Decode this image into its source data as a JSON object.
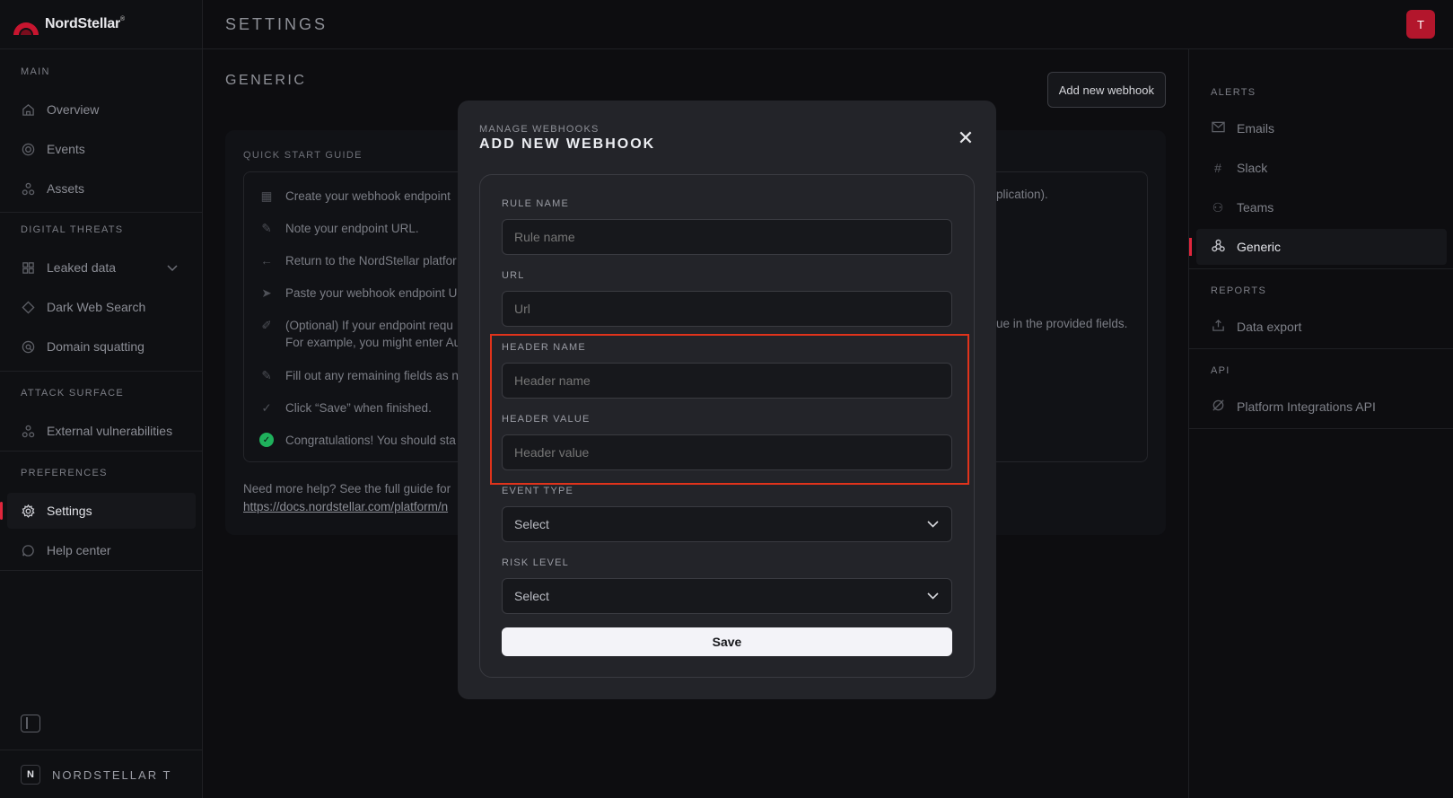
{
  "app": {
    "logo_text": "NordStellar",
    "logo_mark": "®"
  },
  "topbar": {
    "title": "SETTINGS",
    "avatar_letter": "T"
  },
  "sidebar": {
    "sections": [
      {
        "title": "MAIN",
        "items": [
          {
            "label": "Overview",
            "icon": "home-icon"
          },
          {
            "label": "Events",
            "icon": "target-icon"
          },
          {
            "label": "Assets",
            "icon": "assets-icon"
          }
        ]
      },
      {
        "title": "DIGITAL THREATS",
        "items": [
          {
            "label": "Leaked data",
            "icon": "grid-icon"
          },
          {
            "label": "Dark Web Search",
            "icon": "diamond-icon"
          },
          {
            "label": "Domain squatting",
            "icon": "search-icon"
          }
        ]
      },
      {
        "title": "ATTACK SURFACE",
        "items": [
          {
            "label": "External vulnerabilities",
            "icon": "assets-icon"
          }
        ]
      },
      {
        "title": "PREFERENCES",
        "items": [
          {
            "label": "Settings",
            "icon": "gear-icon"
          },
          {
            "label": "Help center",
            "icon": "chat-icon"
          }
        ]
      }
    ],
    "org_badge": "N",
    "org_name": "NORDSTELLAR T"
  },
  "main": {
    "section_title": "GENERIC",
    "add_button": "Add new webhook",
    "guide": {
      "title": "QUICK START GUIDE",
      "steps": [
        "Create your webhook endpoint",
        "Note your endpoint URL.",
        "Return to the NordStellar platfor",
        "Paste your webhook endpoint U",
        "(Optional) If your endpoint requ",
        "For example, you might enter Au",
        "Fill out any remaining fields as n",
        "Click “Save” when finished.",
        "Congratulations! You should sta"
      ],
      "step1_tail": "plication).",
      "step5_tail": "ue in the provided fields.",
      "help_text": "Need more help? See the full guide for",
      "help_link": "https://docs.nordstellar.com/platform/n"
    }
  },
  "rightbar": {
    "sections": [
      {
        "title": "ALERTS",
        "items": [
          {
            "label": "Emails",
            "icon": "mail-icon"
          },
          {
            "label": "Slack",
            "icon": "slack-icon"
          },
          {
            "label": "Teams",
            "icon": "teams-icon"
          },
          {
            "label": "Generic",
            "icon": "webhook-icon"
          }
        ]
      },
      {
        "title": "REPORTS",
        "items": [
          {
            "label": "Data export",
            "icon": "export-icon"
          }
        ]
      },
      {
        "title": "API",
        "items": [
          {
            "label": "Platform Integrations API",
            "icon": "api-icon"
          }
        ]
      }
    ]
  },
  "modal": {
    "overtitle": "MANAGE WEBHOOKS",
    "title": "ADD NEW WEBHOOK",
    "fields": {
      "rule_name": {
        "label": "RULE NAME",
        "placeholder": "Rule name"
      },
      "url": {
        "label": "URL",
        "placeholder": "Url"
      },
      "header_name": {
        "label": "HEADER NAME",
        "placeholder": "Header name"
      },
      "header_value": {
        "label": "HEADER VALUE",
        "placeholder": "Header value"
      },
      "event_type": {
        "label": "EVENT TYPE",
        "value": "Select"
      },
      "risk_level": {
        "label": "RISK LEVEL",
        "value": "Select"
      }
    },
    "save_label": "Save",
    "highlight_color": "#e0331b"
  },
  "colors": {
    "accent": "#e0263c",
    "background": "#0d0d10",
    "success": "#1fb15c"
  }
}
